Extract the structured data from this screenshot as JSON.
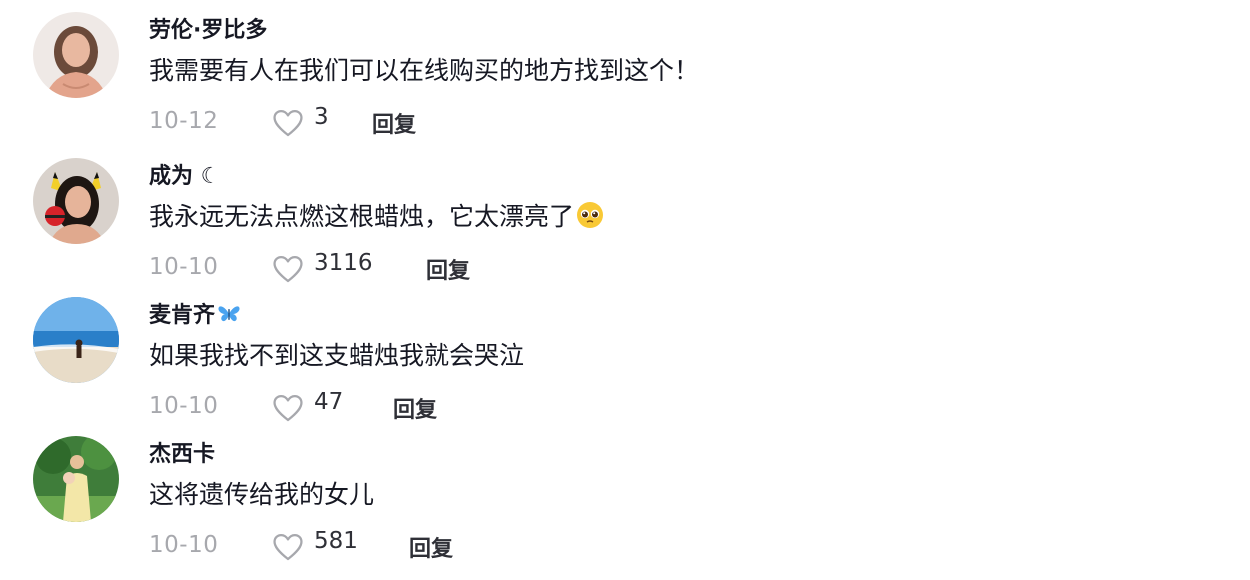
{
  "comments": [
    {
      "username": "劳伦·罗比多",
      "text": "我需要有人在我们可以在线购买的地方找到这个！",
      "date": "10-12",
      "likes": "3",
      "reply_label": "回复"
    },
    {
      "username": "成为 ☾",
      "text": "我永远无法点燃这根蜡烛，它太漂亮了",
      "text_emoji": "pleading-face-emoji",
      "date": "10-10",
      "likes": "3116",
      "reply_label": "回复"
    },
    {
      "username": "麦肯齐",
      "username_emoji": "butterfly-emoji",
      "text": "如果我找不到这支蜡烛我就会哭泣",
      "date": "10-10",
      "likes": "47",
      "reply_label": "回复"
    },
    {
      "username": "杰西卡",
      "text": "这将遗传给我的女儿",
      "date": "10-10",
      "likes": "581",
      "reply_label": "回复"
    }
  ],
  "colors": {
    "text": "#161823",
    "muted": "#a7a8ad",
    "secondary": "#2f3037"
  }
}
